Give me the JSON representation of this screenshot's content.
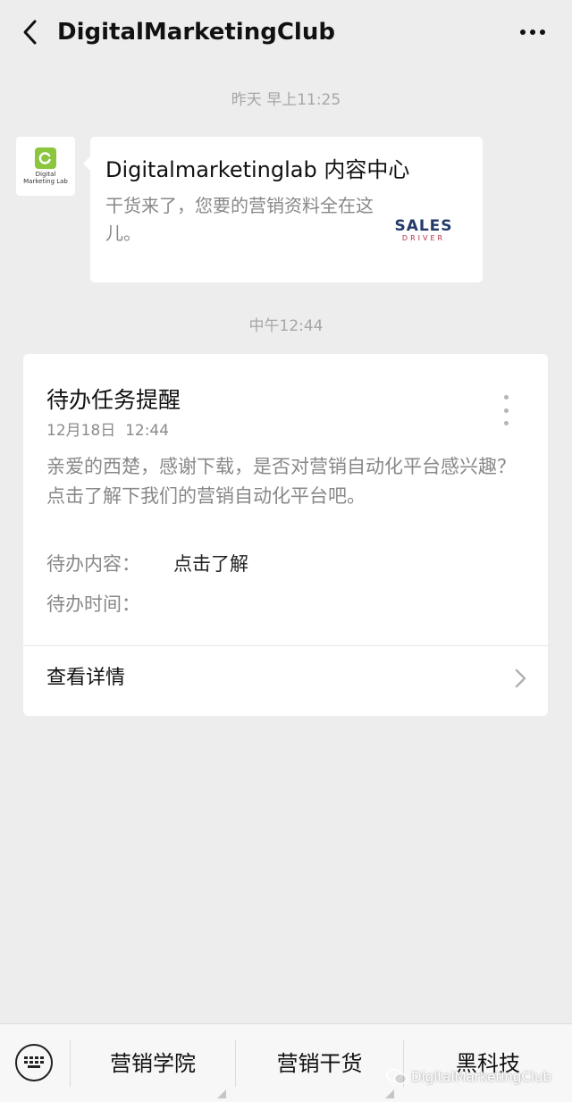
{
  "header": {
    "title": "DigitalMarketingClub"
  },
  "messages": {
    "timestamp_1": "昨天 早上11:25",
    "timestamp_2": "中午12:44",
    "avatar_text": "Digital\nMarketing Lab",
    "link_card": {
      "title": "Digitalmarketinglab 内容中心",
      "description": "干货来了，您要的营销资料全在这儿。",
      "thumb_main": "SALES",
      "thumb_sub": "DRIVER"
    },
    "task_card": {
      "title": "待办任务提醒",
      "date": "12月18日  12:44",
      "body": "亲爱的西楚，感谢下载，是否对营销自动化平台感兴趣？点击了解下我们的营销自动化平台吧。",
      "content_label": "待办内容：",
      "content_value": "点击了解",
      "time_label": "待办时间：",
      "details_label": "查看详情"
    }
  },
  "bottom_menu": {
    "items": [
      "营销学院",
      "营销干货",
      "黑科技"
    ],
    "watermark": "DigitalMarketingClub"
  },
  "colors": {
    "background": "#ededed",
    "card": "#ffffff",
    "avatar_green": "#8cc63f",
    "thumb_navy": "#233a6b",
    "thumb_red": "#b03040"
  }
}
